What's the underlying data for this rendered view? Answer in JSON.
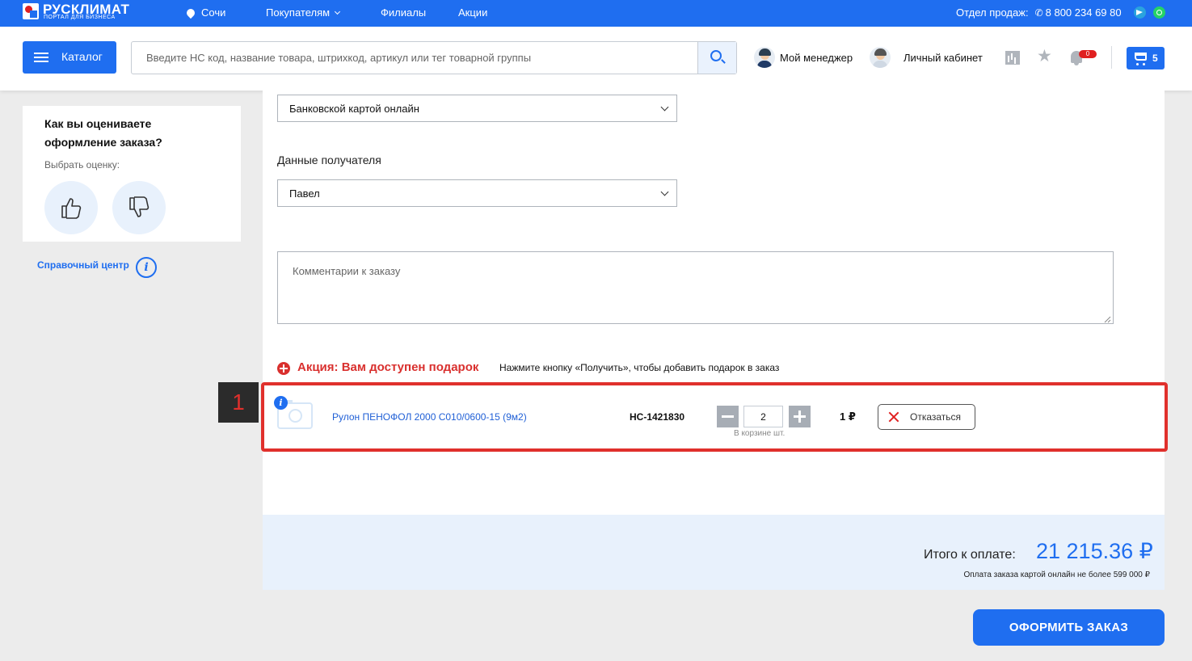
{
  "brand": {
    "name": "РУСКЛИМАТ",
    "tagline": "ПОРТАЛ ДЛЯ БИЗНЕСА"
  },
  "topbar": {
    "city": "Сочи",
    "nav": {
      "buyers": "Покупателям",
      "branches": "Филиалы",
      "promos": "Акции"
    },
    "sales_label": "Отдел продаж:",
    "phone": "8 800 234 69 80"
  },
  "header": {
    "catalog_label": "Каталог",
    "search_placeholder": "Введите НС код, название товара, штрихкод, артикул или тег товарной группы",
    "manager_label": "Мой менеджер",
    "account_label": "Личный кабинет",
    "notifications_count": "0",
    "cart_count": "5"
  },
  "sidebar": {
    "rating_title": "Как вы оцениваете оформление заказа?",
    "rating_sub": "Выбрать оценку:",
    "help_link": "Справочный центр"
  },
  "form": {
    "payment_method": "Банковской картой онлайн",
    "recipient_label": "Данные получателя",
    "recipient_value": "Павел",
    "comment_placeholder": "Комментарии к заказу"
  },
  "promo": {
    "title": "Акция: Вам доступен подарок",
    "hint": "Нажмите кнопку «Получить», чтобы добавить подарок в заказ",
    "item": {
      "name": "Рулон ПЕНОФОЛ 2000 С010/0600-15 (9м2)",
      "sku": "НС-1421830",
      "quantity": "2",
      "quantity_caption": "В корзине шт.",
      "price": "1 ₽",
      "decline_label": "Отказаться"
    }
  },
  "annotation": {
    "step": "1"
  },
  "total": {
    "label": "Итого к оплате:",
    "value": "21 215.36 ₽",
    "note": "Оплата заказа картой онлайн не более 599 000 ₽"
  },
  "submit_label": "ОФОРМИТЬ ЗАКАЗ"
}
